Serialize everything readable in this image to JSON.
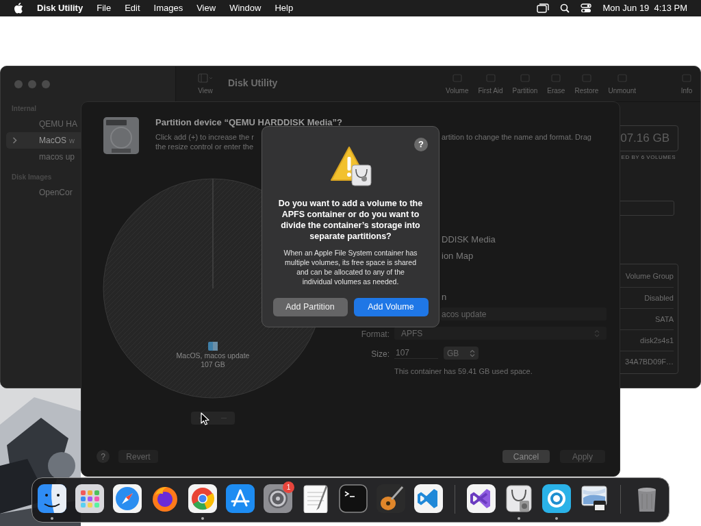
{
  "menubar": {
    "app": "Disk Utility",
    "menus": [
      "File",
      "Edit",
      "Images",
      "View",
      "Window",
      "Help"
    ],
    "clock": "Mon Jun 19  4:13 PM"
  },
  "window": {
    "title": "Disk Utility",
    "view_label": "View",
    "toolbar": [
      "Volume",
      "First Aid",
      "Partition",
      "Erase",
      "Restore",
      "Unmount",
      "Info"
    ],
    "sidebar": [
      {
        "heading": "Internal",
        "items": [
          {
            "label": "QEMU HA",
            "selected": false,
            "disclosure": false
          },
          {
            "label": "MacOS",
            "suffix": "w",
            "selected": true,
            "disclosure": true
          },
          {
            "label": "macos up",
            "selected": false,
            "disclosure": false
          }
        ]
      },
      {
        "heading": "Disk Images",
        "items": [
          {
            "label": "OpenCor",
            "selected": false,
            "disclosure": false
          }
        ]
      }
    ],
    "capacity": "07.16 GB",
    "capacity_caption": "ED BY 6 VOLUMES",
    "info_values": [
      "Volume Group",
      "Disabled",
      "SATA",
      "disk2s4s1",
      "34A7BD09F…"
    ]
  },
  "sheet": {
    "title": "Partition device “QEMU HARDDISK Media”?",
    "description_left": [
      "Click add (+) to increase the r",
      "the resize control or enter the"
    ],
    "description_right": "artition to change the name and format. Drag",
    "pie_label": "MacOS, macos update",
    "pie_size": "107 GB",
    "fragments": [
      "DDISK Media",
      "ion Map",
      "n"
    ],
    "name_value": "acos update",
    "format_label": "Format:",
    "format_value": "APFS",
    "size_label": "Size:",
    "size_value": "107",
    "size_unit": "GB",
    "note": "This container has 59.41 GB used space.",
    "help": "?",
    "buttons": [
      {
        "label": "Revert",
        "disabled": true
      },
      {
        "label": "Cancel",
        "disabled": false
      },
      {
        "label": "Apply",
        "disabled": true
      }
    ]
  },
  "alert": {
    "help": "?",
    "question": "Do you want to add a volume to the APFS container or do you want to divide the container’s storage into separate partitions?",
    "body": "When an Apple File System container has multiple volumes, its free space is shared and can be allocated to any of the individual volumes as needed.",
    "buttons": [
      {
        "label": "Add Partition",
        "default": false
      },
      {
        "label": "Add Volume",
        "default": true
      }
    ]
  },
  "dock": [
    {
      "kind": "finder",
      "running": true
    },
    {
      "kind": "launchpad",
      "running": false
    },
    {
      "kind": "safari",
      "running": false
    },
    {
      "kind": "firefox",
      "running": false
    },
    {
      "kind": "chrome",
      "running": true
    },
    {
      "kind": "appstore",
      "running": false
    },
    {
      "kind": "settings",
      "running": false,
      "badge": "1"
    },
    {
      "kind": "textedit",
      "running": false
    },
    {
      "kind": "terminal",
      "running": false
    },
    {
      "kind": "guitar",
      "running": false
    },
    {
      "kind": "vscode",
      "running": false
    },
    {
      "kind": "separator"
    },
    {
      "kind": "visualstudio",
      "running": false
    },
    {
      "kind": "diskutility",
      "running": true
    },
    {
      "kind": "target",
      "running": true
    },
    {
      "kind": "preview",
      "running": false
    },
    {
      "kind": "separator"
    },
    {
      "kind": "trash",
      "running": false
    }
  ]
}
